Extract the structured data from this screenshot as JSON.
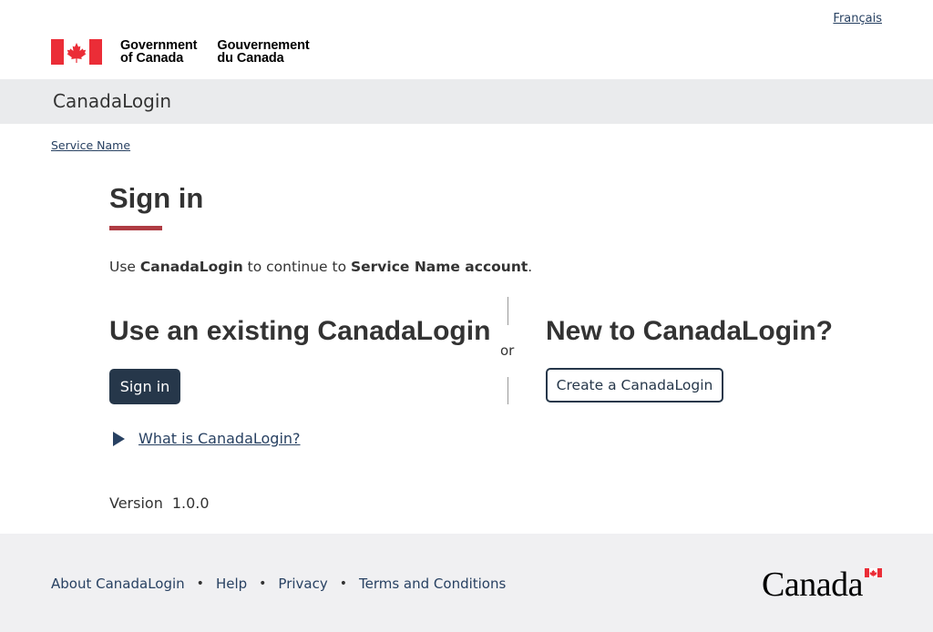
{
  "header": {
    "language_toggle": "Français",
    "gov_en_line1": "Government",
    "gov_en_line2": "of Canada",
    "gov_fr_line1": "Gouvernement",
    "gov_fr_line2": "du Canada",
    "flag_color": "#eb2d37"
  },
  "app_bar": {
    "title": "CanadaLogin"
  },
  "breadcrumb": {
    "item": "Service Name"
  },
  "main": {
    "title": "Sign in",
    "intro_prefix": "Use ",
    "intro_bold_1": "CanadaLogin",
    "intro_middle": " to continue to ",
    "intro_bold_2": "Service Name account",
    "intro_suffix": ".",
    "existing_heading": "Use an existing CanadaLogin",
    "signin_button": "Sign in",
    "or_label": "or",
    "new_heading": "New to CanadaLogin?",
    "create_button": "Create a CanadaLogin",
    "details_summary": "What is CanadaLogin?",
    "version_label": "Version",
    "version_value": "1.0.0"
  },
  "footer": {
    "links": [
      "About CanadaLogin",
      "Help",
      "Privacy",
      "Terms and Conditions"
    ],
    "wordmark": "Canada"
  },
  "colors": {
    "primary": "#26374a",
    "link": "#284162",
    "accent_rule": "#af3c43",
    "app_bar_bg": "#eaebed",
    "footer_bg": "#f0f0f2"
  }
}
